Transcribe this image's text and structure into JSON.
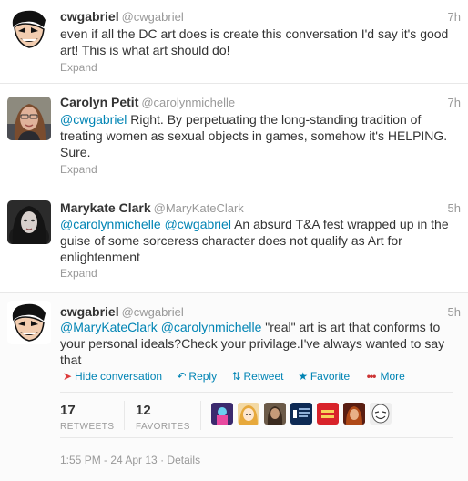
{
  "tweets": [
    {
      "fullname": "cwgabriel",
      "username": "@cwgabriel",
      "time": "7h",
      "text": "even if all the DC art does is create this conversation I'd say it's good art! This is what art should do!",
      "expand": "Expand"
    },
    {
      "fullname": "Carolyn Petit",
      "username": "@carolynmichelle",
      "time": "7h",
      "mention1": "@cwgabriel",
      "text": " Right. By perpetuating the long-standing tradition of treating women as sexual objects in games, somehow it's HELPING. Sure.",
      "expand": "Expand"
    },
    {
      "fullname": "Marykate Clark",
      "username": "@MaryKateClark",
      "time": "5h",
      "mention1": "@carolynmichelle",
      "mention2": "@cwgabriel",
      "text": " An absurd T&A fest wrapped up in the guise of some sorceress character does not qualify as Art for enlightenment",
      "expand": "Expand"
    },
    {
      "fullname": "cwgabriel",
      "username": "@cwgabriel",
      "time": "5h",
      "mention1": "@MaryKateClark",
      "mention2": "@carolynmichelle",
      "text": "  \"real\" art is art that conforms to your personal ideals?Check your privilage.I've always wanted to say that"
    }
  ],
  "actions": {
    "hide": "Hide conversation",
    "reply": "Reply",
    "retweet": "Retweet",
    "favorite": "Favorite",
    "more": "More"
  },
  "stats": {
    "retweets_count": "17",
    "retweets_label": "RETWEETS",
    "favorites_count": "12",
    "favorites_label": "FAVORITES"
  },
  "footer": {
    "timestamp": "1:55 PM - 24 Apr 13",
    "separator": "·",
    "details": "Details"
  },
  "colors": {
    "link": "#0084b4",
    "muted": "#999999",
    "text": "#333333"
  }
}
